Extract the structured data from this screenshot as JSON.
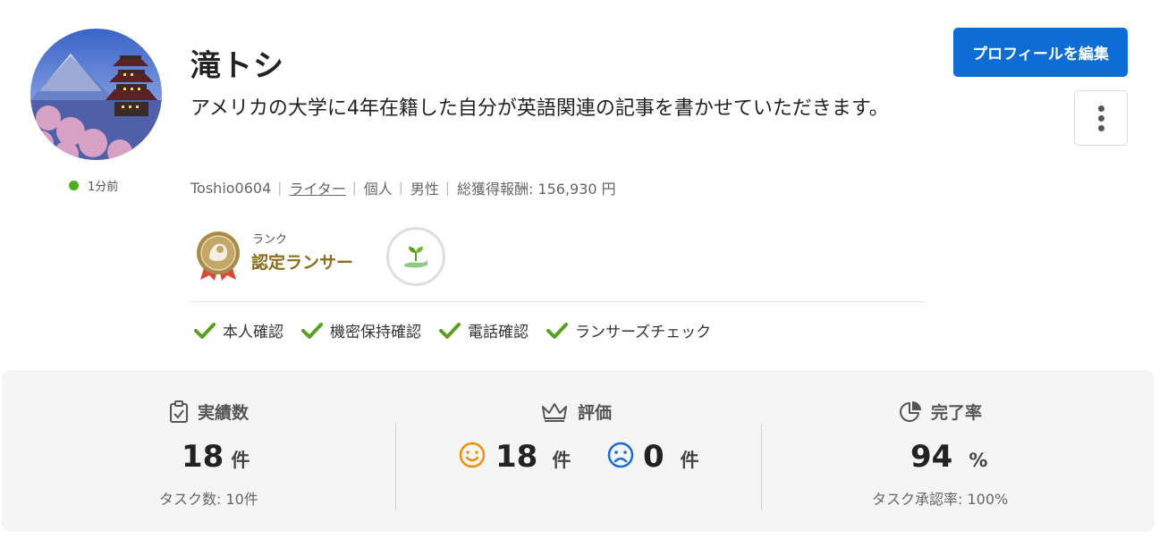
{
  "profile": {
    "name": "滝トシ",
    "catchphrase": "アメリカの大学に4年在籍した自分が英語関連の記事を書かせていただきます。",
    "online_status": "1分前",
    "username": "Toshio0604",
    "role": "ライター",
    "type": "個人",
    "gender": "男性",
    "total_earnings": "総獲得報酬: 156,930 円"
  },
  "rank": {
    "label": "ランク",
    "name": "認定ランサー"
  },
  "verifications": [
    "本人確認",
    "機密保持確認",
    "電話確認",
    "ランサーズチェック"
  ],
  "actions": {
    "edit_profile": "プロフィールを編集"
  },
  "stats": {
    "achievements": {
      "title": "実績数",
      "value": "18",
      "unit": "件",
      "sub": "タスク数: 10件"
    },
    "rating": {
      "title": "評価",
      "good": "18",
      "good_unit": "件",
      "bad": "0",
      "bad_unit": "件"
    },
    "completion": {
      "title": "完了率",
      "value": "94",
      "unit": "%",
      "sub": "タスク承認率: 100%"
    }
  },
  "colors": {
    "accent": "#0e6dd4",
    "online": "#4caf20",
    "check": "#5aa01e",
    "rank_gold": "#8a6d1d",
    "good_face": "#f0900a",
    "bad_face": "#1a6fd0"
  },
  "icons": [
    "check-icon",
    "clipboard-check-icon",
    "crown-icon",
    "pie-chart-icon",
    "smile-icon",
    "sad-icon",
    "sprout-icon",
    "more-vertical-icon"
  ]
}
